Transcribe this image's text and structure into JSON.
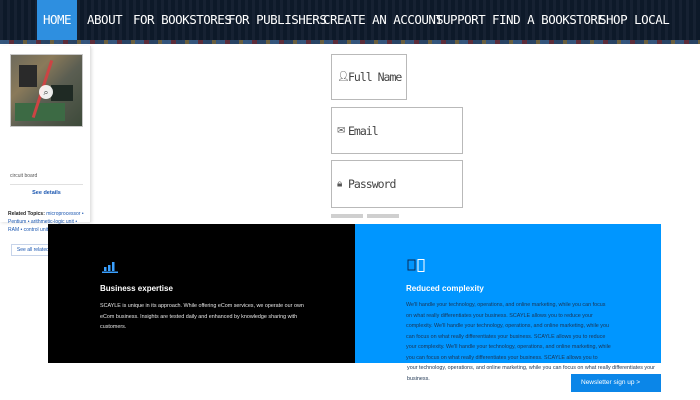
{
  "nav": {
    "items": [
      {
        "label": "HOME"
      },
      {
        "label": "ABOUT"
      },
      {
        "label": "FOR BOOKSTORES"
      },
      {
        "label": "FOR PUBLISHERS"
      },
      {
        "label": "CREATE AN ACCOUNT"
      },
      {
        "label": "SUPPORT"
      },
      {
        "label": "FIND A BOOKSTORE"
      },
      {
        "label": "SHOP LOCAL"
      }
    ],
    "active": "HOME",
    "active_color": "#2e8fe0"
  },
  "sidebar": {
    "image_icon": "magnify-icon",
    "caption": "circuit board",
    "see_details": "See details",
    "related_label": "Related Topics:",
    "related_text": "microprocessor • Pentium • arithmetic-logic unit • RAM • control unit",
    "see_all": "See all related content →"
  },
  "form": {
    "fields": [
      {
        "icon": "user-icon",
        "placeholder": "Full Name"
      },
      {
        "icon": "envelope-icon",
        "placeholder": "Email"
      },
      {
        "icon": "lock-icon",
        "placeholder": "Password"
      }
    ]
  },
  "features": {
    "dark": {
      "icon": "bar-chart-icon",
      "title": "Business expertise",
      "body": "SCAYLE is unique in its approach. While offering eCom services, we operate our own eCom business. Insights are tested daily and enhanced by knowledge sharing with customers."
    },
    "blue": {
      "icon": "window-icon",
      "title": "Reduced complexity",
      "body": "We'll handle your technology, operations, and online marketing, while you can focus on what really differentiates your business. SCAYLE allows you to reduce your complexity. We'll handle your technology, operations, and online marketing, while you can focus on what really differentiates your business. SCAYLE allows you to reduce your complexity. We'll handle your technology, operations, and online marketing, while you can focus on what really differentiates your business. SCAYLE allows you to reduce your complexity. We'll handle",
      "overflow": "your technology, operations, and online marketing, while you can focus on what really differentiates your business."
    },
    "blue_color": "#0096ff"
  },
  "newsletter": {
    "label": "Newsletter sign up >"
  }
}
